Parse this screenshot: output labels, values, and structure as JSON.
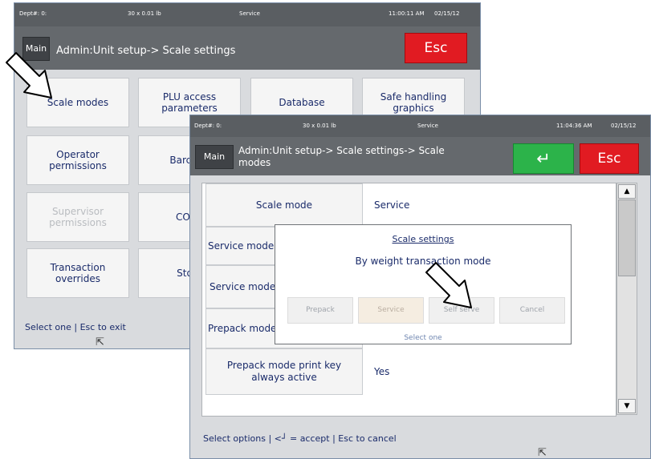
{
  "back_window": {
    "topbar": {
      "dept": "Dept#: 0:",
      "weight": "30 x 0.01 lb",
      "mode": "Service",
      "time": "11:00:11 AM",
      "date": "02/15/12"
    },
    "header": {
      "main_label": "Main",
      "breadcrumb": "Admin:Unit setup-> Scale settings",
      "esc_label": "Esc"
    },
    "buttons": [
      {
        "label": "Scale modes",
        "enabled": true
      },
      {
        "label": "PLU access parameters",
        "enabled": true
      },
      {
        "label": "Database",
        "enabled": true
      },
      {
        "label": "Safe handling graphics",
        "enabled": true
      },
      {
        "label": "Operator permissions",
        "enabled": true
      },
      {
        "label": "Barcode",
        "enabled": true
      },
      {
        "label": "Supervisor permissions",
        "enabled": false
      },
      {
        "label": "COOL",
        "enabled": true
      },
      {
        "label": "Transaction overrides",
        "enabled": true
      },
      {
        "label": "Store",
        "enabled": true
      }
    ],
    "footer": "Select one | Esc to exit"
  },
  "front_window": {
    "topbar": {
      "dept": "Dept#: 0:",
      "weight": "30 x 0.01 lb",
      "mode": "Service",
      "time": "11:04:36 AM",
      "date": "02/15/12"
    },
    "header": {
      "main_label": "Main",
      "breadcrumb": "Admin:Unit setup-> Scale settings-> Scale modes",
      "enter_icon": "enter-arrow",
      "esc_label": "Esc"
    },
    "rows": [
      {
        "label": "Scale mode",
        "value": "Service"
      },
      {
        "label": "Service mode",
        "value": ""
      },
      {
        "label": "Service mode a",
        "value": ""
      },
      {
        "label": "Prepack mode",
        "value": ""
      },
      {
        "label": "Prepack mode print key always active",
        "value": "Yes"
      }
    ],
    "scrollbar": {
      "up_icon": "▲",
      "down_icon": "▼"
    },
    "footer": "Select options | <┘ = accept | Esc to cancel"
  },
  "dialog": {
    "title": "Scale settings",
    "message": "By weight transaction mode",
    "buttons": [
      "Prepack",
      "Service",
      "Self serve",
      "Cancel"
    ],
    "selected": "Service",
    "footer": "Select one"
  },
  "colors": {
    "esc": "#e11b22",
    "enter": "#2cb34a",
    "header": "#65696d",
    "topbar": "#5a5e62",
    "text": "#1a2b6a"
  }
}
